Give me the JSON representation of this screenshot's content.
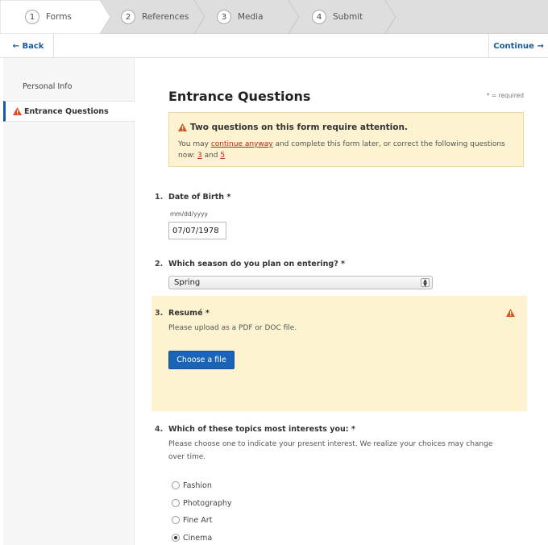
{
  "stepper": {
    "steps": [
      {
        "num": "1",
        "label": "Forms"
      },
      {
        "num": "2",
        "label": "References"
      },
      {
        "num": "3",
        "label": "Media"
      },
      {
        "num": "4",
        "label": "Submit"
      }
    ]
  },
  "nav": {
    "back_label": "← Back",
    "continue_label": "Continue →"
  },
  "sidebar": {
    "items": [
      {
        "label": "Personal Info"
      },
      {
        "label": "Entrance Questions"
      }
    ]
  },
  "main": {
    "title": "Entrance Questions",
    "required_note": "* = required",
    "alert": {
      "title": "Two questions on this form require attention.",
      "text_before": "You may ",
      "link_continue": "continue anyway",
      "text_middle": " and complete this form later, or correct the following questions now: ",
      "link_q3": "3",
      "text_and": " and ",
      "link_q5": "5"
    },
    "questions": [
      {
        "num": "1.",
        "label": "Date of Birth *",
        "hint": "mm/dd/yyyy",
        "value": "07/07/1978"
      },
      {
        "num": "2.",
        "label": "Which season do you plan on entering? *",
        "selected": "Spring"
      },
      {
        "num": "3.",
        "label": "Resumé *",
        "help": "Please upload as a PDF or DOC file.",
        "button": "Choose a file"
      },
      {
        "num": "4.",
        "label": "Which of these topics most interests you: *",
        "help_line1": "Please choose one to indicate your present interest. We realize your choices may change",
        "help_line2": "over time.",
        "options": [
          {
            "label": "Fashion",
            "checked": false
          },
          {
            "label": "Photography",
            "checked": false
          },
          {
            "label": "Fine Art",
            "checked": false
          },
          {
            "label": "Cinema",
            "checked": true
          }
        ]
      }
    ]
  },
  "colors": {
    "accent": "#1a5a9c",
    "button": "#1a63b5",
    "warning_bg": "#fdf3d1",
    "warning_icon": "#d9531e",
    "error_link": "#b0271a"
  }
}
